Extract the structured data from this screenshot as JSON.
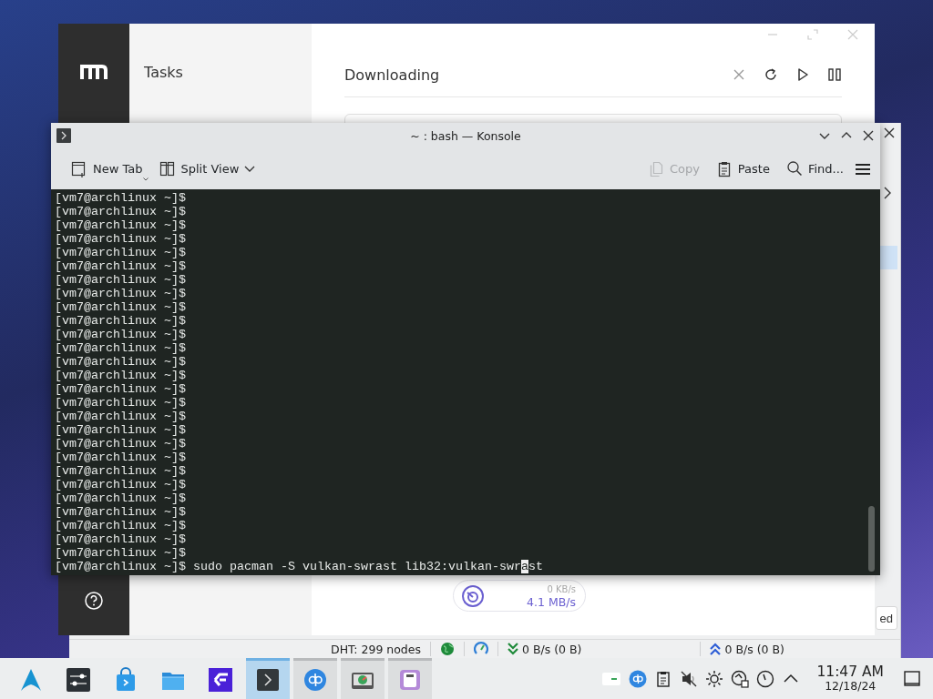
{
  "qbittorrent": {
    "button_label": "ed",
    "status_bar": {
      "dht": "DHT: 299 nodes",
      "download": "0 B/s (0 B)",
      "upload": "0 B/s (0 B)"
    }
  },
  "motrix": {
    "tasks_title": "Tasks",
    "list_title": "Downloading",
    "speed": {
      "upload": "0 KB/s",
      "download": "4.1 MB/s"
    }
  },
  "konsole": {
    "title": "~ : bash — Konsole",
    "left_tools": [
      {
        "kind": "new-tab",
        "label": "New Tab",
        "disabled": false
      },
      {
        "kind": "split-view",
        "label": "Split View",
        "disabled": false
      }
    ],
    "right_tools": [
      {
        "kind": "copy",
        "label": "Copy",
        "disabled": true
      },
      {
        "kind": "paste",
        "label": "Paste",
        "disabled": false
      },
      {
        "kind": "find",
        "label": "Find...",
        "disabled": false
      }
    ],
    "lines": [
      "[vm7@archlinux ~]$",
      "[vm7@archlinux ~]$",
      "[vm7@archlinux ~]$",
      "[vm7@archlinux ~]$",
      "[vm7@archlinux ~]$",
      "[vm7@archlinux ~]$",
      "[vm7@archlinux ~]$",
      "[vm7@archlinux ~]$",
      "[vm7@archlinux ~]$",
      "[vm7@archlinux ~]$",
      "[vm7@archlinux ~]$",
      "[vm7@archlinux ~]$",
      "[vm7@archlinux ~]$",
      "[vm7@archlinux ~]$",
      "[vm7@archlinux ~]$",
      "[vm7@archlinux ~]$",
      "[vm7@archlinux ~]$",
      "[vm7@archlinux ~]$",
      "[vm7@archlinux ~]$",
      "[vm7@archlinux ~]$",
      "[vm7@archlinux ~]$",
      "[vm7@archlinux ~]$",
      "[vm7@archlinux ~]$",
      "[vm7@archlinux ~]$",
      "[vm7@archlinux ~]$",
      "[vm7@archlinux ~]$",
      "[vm7@archlinux ~]$"
    ],
    "input_line": {
      "before_cursor": "[vm7@archlinux ~]$ sudo pacman -S vulkan-swrast lib32:vulkan-swr",
      "at_cursor": "a",
      "after_cursor": "st"
    }
  },
  "taskbar": {
    "apps": [
      {
        "kind": "launcher",
        "active": false,
        "running": false
      },
      {
        "kind": "sliders",
        "active": false,
        "running": false
      },
      {
        "kind": "bag",
        "active": false,
        "running": false
      },
      {
        "kind": "folder",
        "active": false,
        "running": false
      },
      {
        "kind": "f-logo",
        "active": false,
        "running": false
      },
      {
        "kind": "terminal",
        "active": true,
        "running": true
      },
      {
        "kind": "qb",
        "active": false,
        "running": true
      },
      {
        "kind": "disk",
        "active": false,
        "running": true
      },
      {
        "kind": "floppy",
        "active": false,
        "running": true
      }
    ],
    "tray": [
      {
        "kind": "green-tab"
      },
      {
        "kind": "qb"
      },
      {
        "kind": "clipboard"
      },
      {
        "kind": "muted"
      },
      {
        "kind": "brightness"
      },
      {
        "kind": "network"
      },
      {
        "kind": "gauge"
      },
      {
        "kind": "chevron"
      }
    ],
    "clock": {
      "time": "11:47 AM",
      "date": "12/18/24"
    }
  }
}
